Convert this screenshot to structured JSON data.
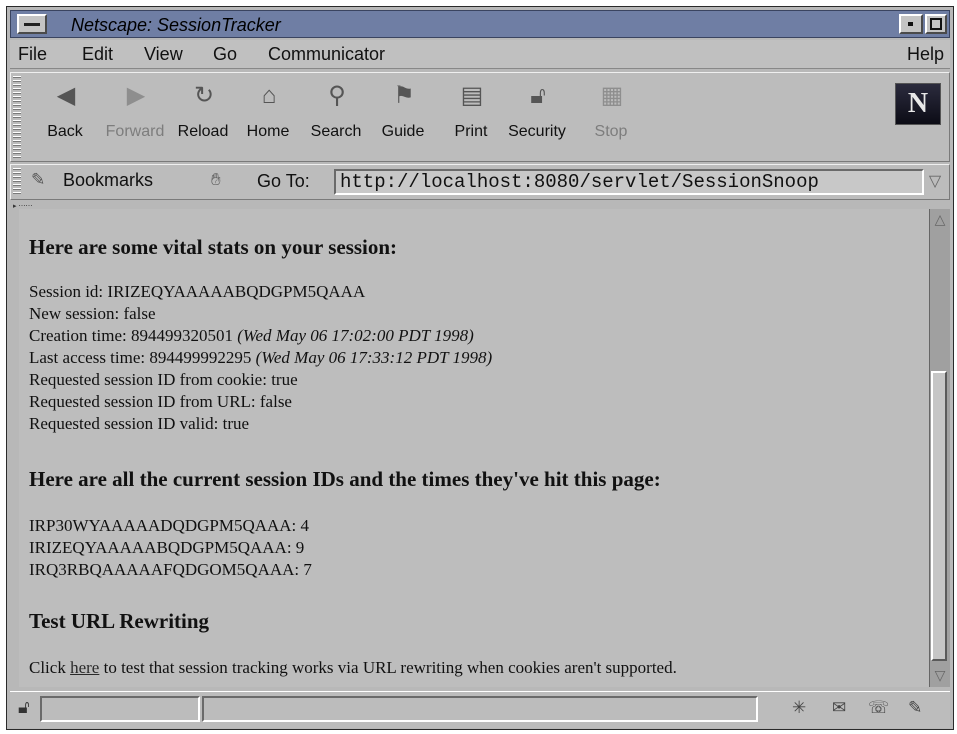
{
  "window": {
    "title": "Netscape: SessionTracker"
  },
  "menubar": {
    "items": [
      "File",
      "Edit",
      "View",
      "Go",
      "Communicator"
    ],
    "help": "Help"
  },
  "toolbar": {
    "buttons": [
      {
        "label": "Back",
        "icon": "back-arrow-icon",
        "enabled": true
      },
      {
        "label": "Forward",
        "icon": "forward-arrow-icon",
        "enabled": false
      },
      {
        "label": "Reload",
        "icon": "reload-icon",
        "enabled": true
      },
      {
        "label": "Home",
        "icon": "home-icon",
        "enabled": true
      },
      {
        "label": "Search",
        "icon": "search-icon",
        "enabled": true
      },
      {
        "label": "Guide",
        "icon": "guide-icon",
        "enabled": true
      },
      {
        "label": "Print",
        "icon": "print-icon",
        "enabled": true
      },
      {
        "label": "Security",
        "icon": "security-lock-icon",
        "enabled": true
      },
      {
        "label": "Stop",
        "icon": "stop-icon",
        "enabled": false
      }
    ],
    "logo": "N"
  },
  "location": {
    "bookmarks_label": "Bookmarks",
    "goto_label": "Go To:",
    "url": "http://localhost:8080/servlet/SessionSnoop"
  },
  "content": {
    "heading1": "Here are some vital stats on your session:",
    "session_id_label": "Session id: ",
    "session_id": "IRIZEQYAAAAABQDGPM5QAAA",
    "new_session_label": "New session: ",
    "new_session": "false",
    "creation_label": "Creation time: ",
    "creation_ms": "894499320501",
    "creation_date": "(Wed May 06 17:02:00 PDT 1998)",
    "last_access_label": "Last access time: ",
    "last_access_ms": "894499992295",
    "last_access_date": "(Wed May 06 17:33:12 PDT 1998)",
    "from_cookie_label": "Requested session ID from cookie: ",
    "from_cookie": "true",
    "from_url_label": "Requested session ID from URL: ",
    "from_url": "false",
    "valid_label": "Requested session ID valid: ",
    "valid": "true",
    "heading2": "Here are all the current session IDs and the times they've hit this page:",
    "sessions": [
      "IRP30WYAAAAADQDGPM5QAAA: 4",
      "IRIZEQYAAAAABQDGPM5QAAA: 9",
      "IRQ3RBQAAAAAFQDGOM5QAAA: 7"
    ],
    "heading3": "Test URL Rewriting",
    "rewrite_prefix": "Click ",
    "rewrite_link": "here",
    "rewrite_suffix": " to test that session tracking works via URL rewriting when cookies aren't supported."
  }
}
